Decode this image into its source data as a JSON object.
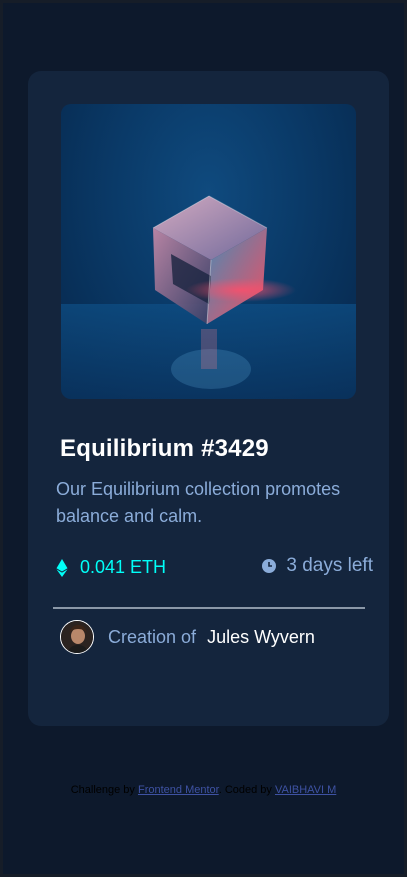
{
  "nft": {
    "title": "Equilibrium #3429",
    "description": "Our Equilibrium collection promotes balance and calm.",
    "price": "0.041 ETH",
    "time_left": "3 days left",
    "creator_prefix": "Creation of",
    "creator_name": "Jules Wyvern"
  },
  "attribution": {
    "prefix": "Challenge by",
    "challenge_link": "Frontend Mentor",
    "middle": ". Coded by",
    "author_link": "VAIBHAVI M"
  },
  "colors": {
    "page_bg": "#0d192c",
    "card_bg": "#14253d",
    "cyan": "#00fff8",
    "soft_blue": "#8bacd9",
    "white": "#ffffff"
  },
  "icons": {
    "price": "ethereum-icon",
    "time": "clock-icon"
  }
}
